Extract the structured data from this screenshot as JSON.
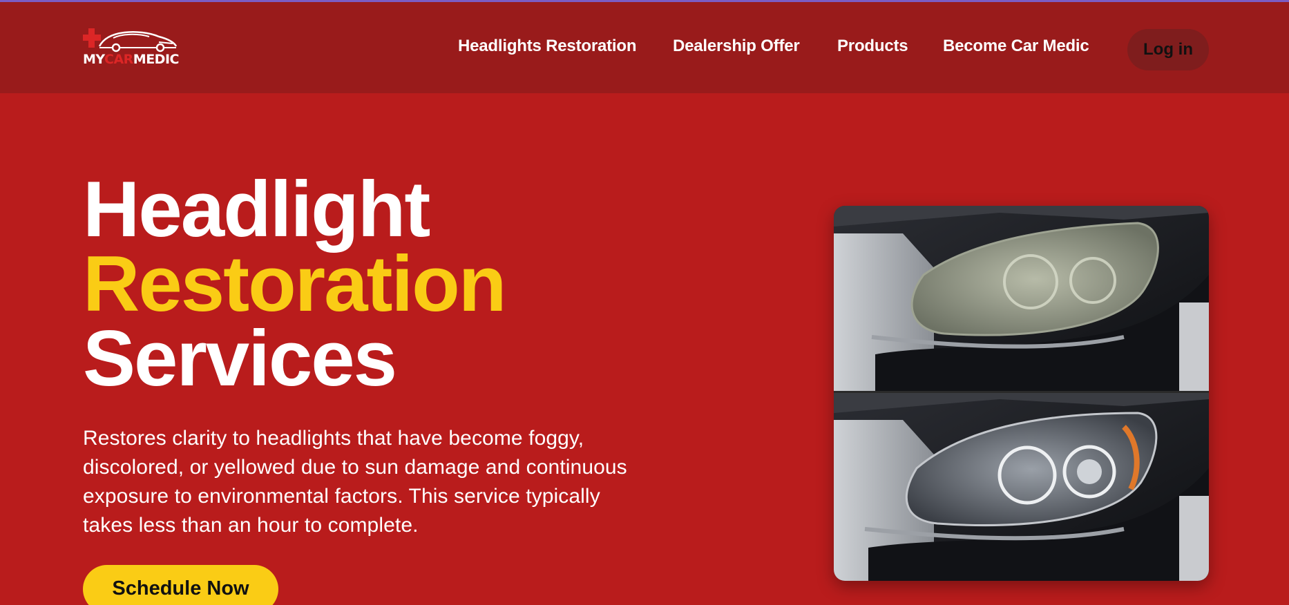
{
  "brand": {
    "logo_prefix": "MY",
    "logo_mid": "CAR",
    "logo_suffix": "MEDIC",
    "colors": {
      "nav_bg": "#991b1b",
      "page_bg": "#b91c1c",
      "accent": "#facc15",
      "login_bg": "#7f1d1d"
    }
  },
  "nav": {
    "links": [
      {
        "label": "Headlights Restoration"
      },
      {
        "label": "Dealership Offer"
      },
      {
        "label": "Products"
      },
      {
        "label": "Become Car Medic"
      }
    ],
    "login_label": "Log in"
  },
  "hero": {
    "title_line1": "Headlight",
    "title_line2": "Restoration",
    "title_line3": "Services",
    "description": "Restores clarity to headlights that have become foggy, discolored, or yellowed due to sun damage and continuous exposure to environmental factors. This service typically takes less than an hour to complete.",
    "cta_label": "Schedule Now",
    "image_icon": "headlight-before-after-photo"
  }
}
